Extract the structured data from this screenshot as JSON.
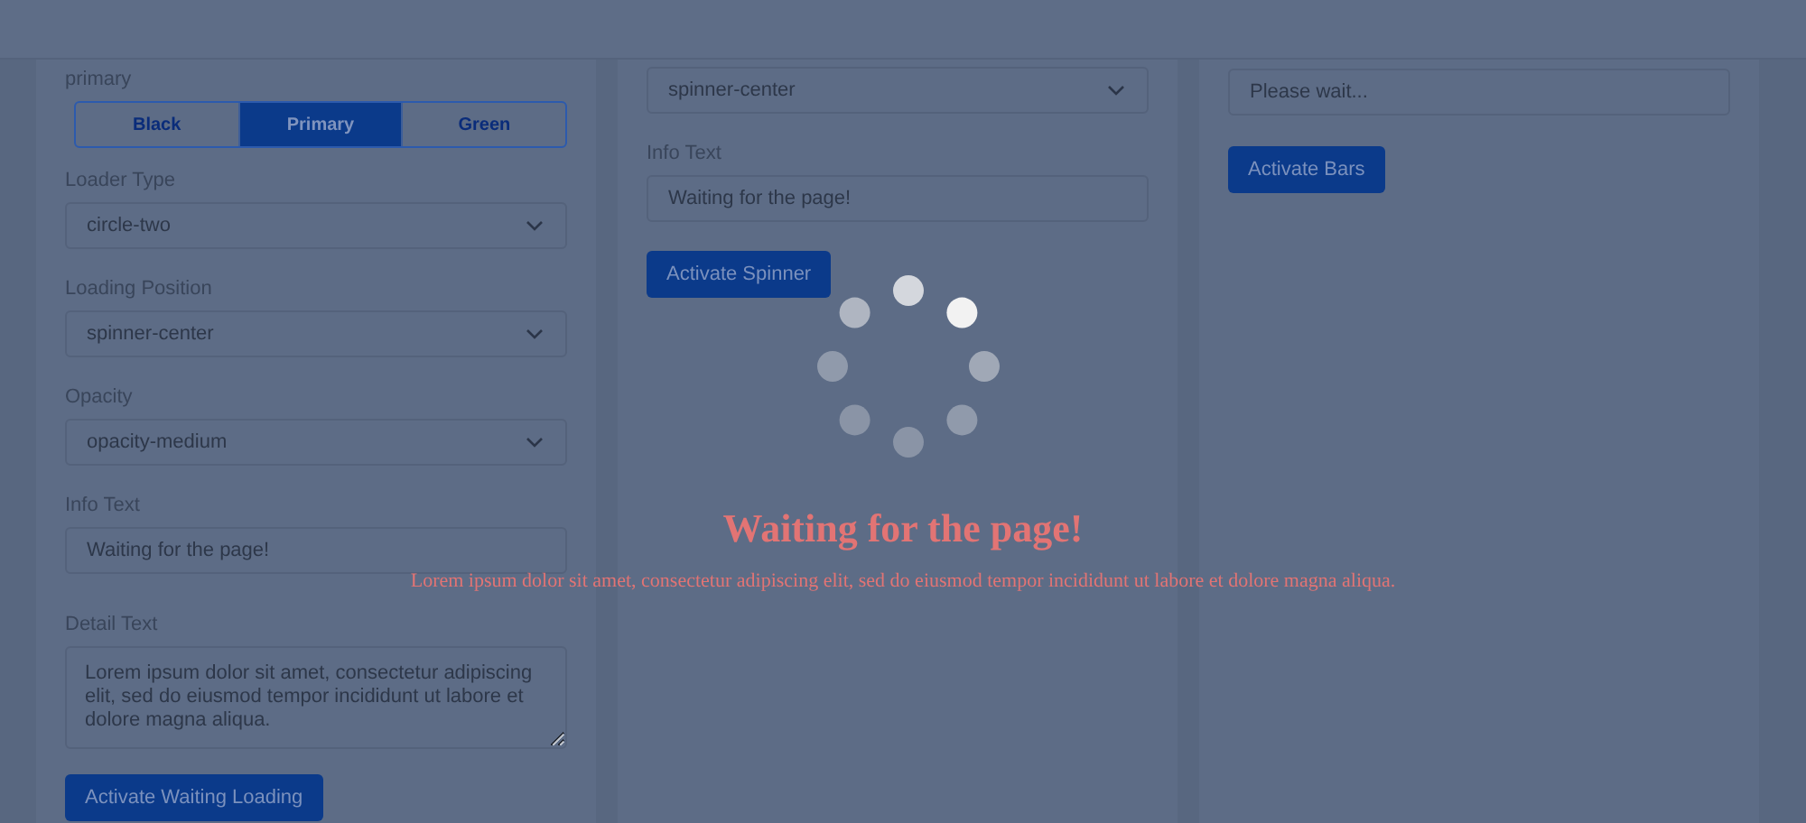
{
  "columns": [
    {
      "toggle_group": {
        "label": "primary",
        "options": [
          {
            "label": "Black",
            "selected": false
          },
          {
            "label": "Primary",
            "selected": true
          },
          {
            "label": "Green",
            "selected": false
          }
        ]
      },
      "fields": [
        {
          "kind": "select",
          "label": "Loader Type",
          "value": "circle-two"
        },
        {
          "kind": "select",
          "label": "Loading Position",
          "value": "spinner-center"
        },
        {
          "kind": "select",
          "label": "Opacity",
          "value": "opacity-medium"
        },
        {
          "kind": "input",
          "label": "Info Text",
          "value": "Waiting for the page!"
        },
        {
          "kind": "textarea",
          "label": "Detail Text",
          "value": "Lorem ipsum dolor sit amet, consectetur adipiscing elit, sed do eiusmod tempor incididunt ut labore et dolore magna aliqua."
        }
      ],
      "button": "Activate Waiting Loading"
    },
    {
      "fields": [
        {
          "kind": "select",
          "value": "spinner-center"
        },
        {
          "kind": "input",
          "label": "Info Text",
          "value": "Waiting for the page!"
        }
      ],
      "button": "Activate Spinner"
    },
    {
      "fields": [
        {
          "kind": "input",
          "value": "Please wait..."
        }
      ],
      "button": "Activate Bars"
    }
  ],
  "overlay": {
    "title": "Waiting for the page!",
    "detail": "Lorem ipsum dolor sit amet, consectetur adipiscing elit, sed do eiusmod tempor incididunt ut labore et dolore magna aliqua."
  }
}
